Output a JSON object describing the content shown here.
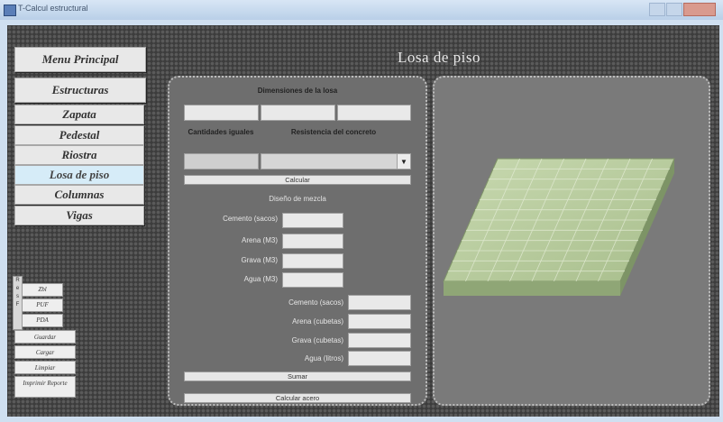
{
  "window": {
    "title": "T-Calcul estructural"
  },
  "menu": {
    "principal": "Menu Principal",
    "estructuras": "Estructuras",
    "items": [
      "Zapata",
      "Pedestal",
      "Riostra",
      "Losa de piso",
      "Columnas",
      "Vigas"
    ],
    "active": "Losa de piso"
  },
  "unit_box": {
    "strip": [
      "R",
      "e",
      "s",
      "F"
    ],
    "buttons": [
      "Zbl",
      "PUF",
      "PDA"
    ]
  },
  "actions": [
    "Guardar",
    "Cargar",
    "Limpiar",
    "Imprimir Reporte"
  ],
  "header": {
    "title": "Losa de piso"
  },
  "panel": {
    "dimensiones_label": "Dimensiones de la losa",
    "dims": [
      "",
      "",
      ""
    ],
    "cantidades_label": "Cantidades iguales",
    "resistencia_label": "Resistencia del concreto",
    "cantidad_value": "",
    "resistencia_value": "",
    "calcular_label": "Calcular",
    "diseno_label": "Diseño de mezcla",
    "mezcla_fields": [
      {
        "label": "Cemento (sacos)",
        "value": ""
      },
      {
        "label": "Arena (M3)",
        "value": ""
      },
      {
        "label": "Grava (M3)",
        "value": ""
      },
      {
        "label": "Agua (M3)",
        "value": ""
      }
    ],
    "resumen_fields": [
      {
        "label": "Cemento (sacos)",
        "value": ""
      },
      {
        "label": "Arena (cubetas)",
        "value": ""
      },
      {
        "label": "Grava (cubetas)",
        "value": ""
      },
      {
        "label": "Agua (litros)",
        "value": ""
      }
    ],
    "sumar_label": "Sumar",
    "calcular_acero_label": "Calcular acero"
  },
  "colors": {
    "accent_active": "#d6ecf8",
    "slab_top": "#b3c79a",
    "slab_side": "#8fa676"
  }
}
